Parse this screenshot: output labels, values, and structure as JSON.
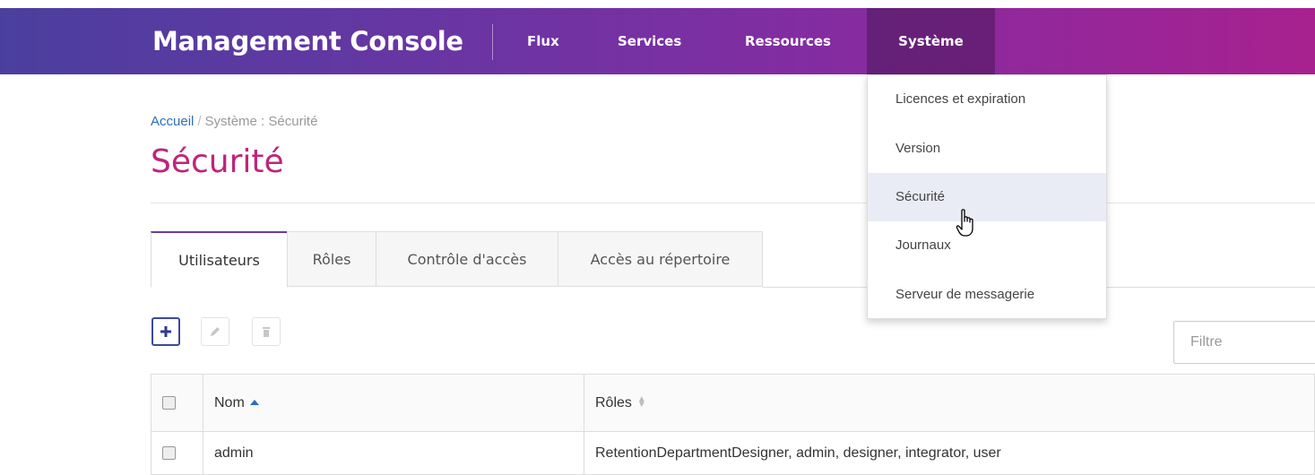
{
  "header": {
    "brand": "Management Console",
    "nav": [
      "Flux",
      "Services",
      "Ressources",
      "Système"
    ],
    "active_nav": "Système",
    "gradient_colors": [
      "#4b3f9e",
      "#a8218f"
    ]
  },
  "dropdown": {
    "items": [
      "Licences et expiration",
      "Version",
      "Sécurité",
      "Journaux",
      "Serveur de messagerie"
    ],
    "hovered": "Sécurité"
  },
  "breadcrumb": {
    "home": "Accueil",
    "separator": "/",
    "current": "Système : Sécurité"
  },
  "page": {
    "title": "Sécurité",
    "title_color": "#c0247a"
  },
  "tabs": {
    "items": [
      "Utilisateurs",
      "Rôles",
      "Contrôle d'accès",
      "Accès au répertoire"
    ],
    "active": "Utilisateurs"
  },
  "toolbar": {
    "add_icon": "plus-icon",
    "edit_icon": "pencil-icon",
    "delete_icon": "trash-icon",
    "filter_placeholder": "Filtre"
  },
  "table": {
    "columns": [
      "Nom",
      "Rôles"
    ],
    "rows": [
      {
        "name": "admin",
        "roles": "RetentionDepartmentDesigner, admin, designer, integrator, user"
      }
    ]
  }
}
